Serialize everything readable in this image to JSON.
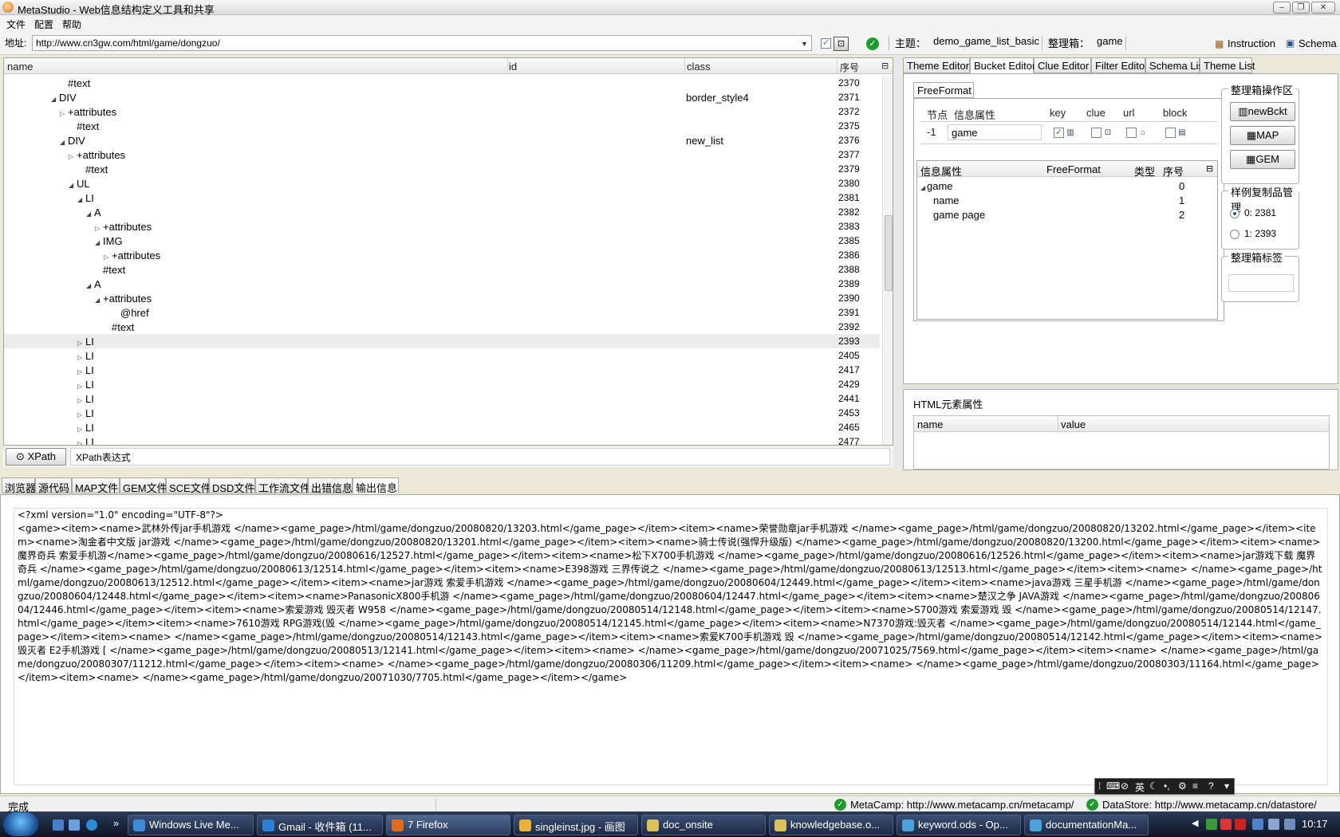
{
  "window": {
    "title": "MetaStudio - Web信息结构定义工具和共享",
    "btn_min": "–",
    "btn_max": "❐",
    "btn_close": "✕"
  },
  "menu": {
    "file": "文件",
    "config": "配置",
    "help": "帮助"
  },
  "address": {
    "label": "地址:",
    "url": "http://www.cn3gw.com/html/game/dongzuo/",
    "theme_label": "主题：",
    "theme_value": "demo_game_list_basic",
    "bucket_label": "整理箱：",
    "bucket_value": "game",
    "instruction": "Instruction",
    "schema": "Schema"
  },
  "tree": {
    "columns": {
      "name": "name",
      "id": "id",
      "class": "class",
      "seq": "序号"
    },
    "rows": [
      {
        "name": "#text",
        "indent": 6,
        "expander": "",
        "class": "",
        "seq": "2370"
      },
      {
        "name": "DIV",
        "indent": 5,
        "expander": "◢",
        "class": "border_style4",
        "seq": "2371"
      },
      {
        "name": "+attributes",
        "indent": 6,
        "expander": "▷",
        "class": "",
        "seq": "2372"
      },
      {
        "name": "#text",
        "indent": 7,
        "expander": "",
        "class": "",
        "seq": "2375"
      },
      {
        "name": "DIV",
        "indent": 6,
        "expander": "◢",
        "class": "new_list",
        "seq": "2376"
      },
      {
        "name": "+attributes",
        "indent": 7,
        "expander": "▷",
        "class": "",
        "seq": "2377"
      },
      {
        "name": "#text",
        "indent": 8,
        "expander": "",
        "class": "",
        "seq": "2379"
      },
      {
        "name": "UL",
        "indent": 7,
        "expander": "◢",
        "class": "",
        "seq": "2380"
      },
      {
        "name": "LI",
        "indent": 8,
        "expander": "◢",
        "class": "",
        "seq": "2381"
      },
      {
        "name": "A",
        "indent": 9,
        "expander": "◢",
        "class": "",
        "seq": "2382"
      },
      {
        "name": "+attributes",
        "indent": 10,
        "expander": "▷",
        "class": "",
        "seq": "2383"
      },
      {
        "name": "IMG",
        "indent": 10,
        "expander": "◢",
        "class": "",
        "seq": "2385"
      },
      {
        "name": "+attributes",
        "indent": 11,
        "expander": "▷",
        "class": "",
        "seq": "2386"
      },
      {
        "name": "#text",
        "indent": 10,
        "expander": "",
        "class": "",
        "seq": "2388"
      },
      {
        "name": "A",
        "indent": 9,
        "expander": "◢",
        "class": "",
        "seq": "2389"
      },
      {
        "name": "+attributes",
        "indent": 10,
        "expander": "◢",
        "class": "",
        "seq": "2390"
      },
      {
        "name": "@href",
        "indent": 12,
        "expander": "",
        "class": "",
        "seq": "2391"
      },
      {
        "name": "#text",
        "indent": 11,
        "expander": "",
        "class": "",
        "seq": "2392"
      },
      {
        "name": "LI",
        "indent": 8,
        "expander": "▷",
        "class": "",
        "seq": "2393",
        "selected": true
      },
      {
        "name": "LI",
        "indent": 8,
        "expander": "▷",
        "class": "",
        "seq": "2405"
      },
      {
        "name": "LI",
        "indent": 8,
        "expander": "▷",
        "class": "",
        "seq": "2417"
      },
      {
        "name": "LI",
        "indent": 8,
        "expander": "▷",
        "class": "",
        "seq": "2429"
      },
      {
        "name": "LI",
        "indent": 8,
        "expander": "▷",
        "class": "",
        "seq": "2441"
      },
      {
        "name": "LI",
        "indent": 8,
        "expander": "▷",
        "class": "",
        "seq": "2453"
      },
      {
        "name": "LI",
        "indent": 8,
        "expander": "▷",
        "class": "",
        "seq": "2465"
      },
      {
        "name": "LI",
        "indent": 8,
        "expander": "▷",
        "class": "",
        "seq": "2477"
      }
    ]
  },
  "xpath": {
    "button": "XPath",
    "placeholder": "XPath表达式"
  },
  "right_tabs": [
    "Theme Editor",
    "Bucket Editor",
    "Clue Editor",
    "Filter Editor",
    "Schema List",
    "Theme List"
  ],
  "bucket": {
    "freeformat_tab": "FreeFormat",
    "headers": {
      "node": "节点",
      "info": "信息属性",
      "key": "key",
      "clue": "clue",
      "url": "url",
      "block": "block"
    },
    "node_value": "-1",
    "info_value": "game",
    "prop_columns": {
      "info": "信息属性",
      "ff": "FreeFormat",
      "type": "类型",
      "seq": "序号"
    },
    "props": [
      {
        "name": "game",
        "indent": 0,
        "expander": "◢",
        "seq": "0"
      },
      {
        "name": "name",
        "indent": 1,
        "expander": "",
        "seq": "1"
      },
      {
        "name": "game page",
        "indent": 1,
        "expander": "",
        "seq": "2"
      }
    ],
    "ops_label": "整理箱操作区",
    "btn_new": "newBckt",
    "btn_map": "MAP",
    "btn_gem": "GEM",
    "sample_label": "样例复制品管理",
    "sample1": "0: 2381",
    "sample2": "1: 2393",
    "tag_label": "整理箱标签"
  },
  "html_prop": {
    "title": "HTML元素属性",
    "col_name": "name",
    "col_value": "value"
  },
  "bottom_tabs": [
    "浏览器",
    "源代码",
    "MAP文件",
    "GEM文件",
    "SCE文件",
    "DSD文件",
    "工作流文件",
    "出错信息",
    "输出信息"
  ],
  "output_text": "<?xml version=\"1.0\" encoding=\"UTF-8\"?>\n<game><item><name>武林外传jar手机游戏 </name><game_page>/html/game/dongzuo/20080820/13203.html</game_page></item><item><name>荣誉勋章jar手机游戏 </name><game_page>/html/game/dongzuo/20080820/13202.html</game_page></item><item><name>淘金者中文版 jar游戏 </name><game_page>/html/game/dongzuo/20080820/13201.html</game_page></item><item><name>骑士传说(强悍升级版) </name><game_page>/html/game/dongzuo/20080820/13200.html</game_page></item><item><name>魔界奇兵 索爱手机游</name><game_page>/html/game/dongzuo/20080616/12527.html</game_page></item><item><name>松下X700手机游戏 </name><game_page>/html/game/dongzuo/20080616/12526.html</game_page></item><item><name>jar游戏下载 魔界奇兵 </name><game_page>/html/game/dongzuo/20080613/12514.html</game_page></item><item><name>E398游戏 三界传说之 </name><game_page>/html/game/dongzuo/20080613/12513.html</game_page></item><item><name> </name><game_page>/html/game/dongzuo/20080613/12512.html</game_page></item><item><name>jar游戏 索爱手机游戏 </name><game_page>/html/game/dongzuo/20080604/12449.html</game_page></item><item><name>java游戏 三星手机游 </name><game_page>/html/game/dongzuo/20080604/12448.html</game_page></item><item><name>PanasonicX800手机游 </name><game_page>/html/game/dongzuo/20080604/12447.html</game_page></item><item><name>楚汉之争 JAVA游戏 </name><game_page>/html/game/dongzuo/20080604/12446.html</game_page></item><item><name>索爱游戏 毁灭者 W958 </name><game_page>/html/game/dongzuo/20080514/12148.html</game_page></item><item><name>S700游戏 索爱游戏 毁 </name><game_page>/html/game/dongzuo/20080514/12147.html</game_page></item><item><name>7610游戏 RPG游戏(毁 </name><game_page>/html/game/dongzuo/20080514/12145.html</game_page></item><item><name>N7370游戏:毁灭者 </name><game_page>/html/game/dongzuo/20080514/12144.html</game_page></item><item><name> </name><game_page>/html/game/dongzuo/20080514/12143.html</game_page></item><item><name>索爱K700手机游戏 毁 </name><game_page>/html/game/dongzuo/20080514/12142.html</game_page></item><item><name>毁灭者 E2手机游戏 [ </name><game_page>/html/game/dongzuo/20080513/12141.html</game_page></item><item><name> </name><game_page>/html/game/dongzuo/20071025/7569.html</game_page></item><item><name> </name><game_page>/html/game/dongzuo/20080307/11212.html</game_page></item><item><name> </name><game_page>/html/game/dongzuo/20080306/11209.html</game_page></item><item><name> </name><game_page>/html/game/dongzuo/20080303/11164.html</game_page></item><item><name> </name><game_page>/html/game/dongzuo/20071030/7705.html</game_page></item></game>",
  "ime": {
    "lang": "英"
  },
  "status": {
    "left": "完成",
    "metacamp": "MetaCamp: http://www.metacamp.cn/metacamp/",
    "datastore": "DataStore: http://www.metacamp.cn/datastore/"
  },
  "taskbar": {
    "items": [
      "Windows Live Me...",
      "Gmail - 收件箱 (11...",
      "7 Firefox",
      "singleinst.jpg - 画图",
      "doc_onsite",
      "knowledgebase.o...",
      "keyword.ods - Op...",
      "documentationMa..."
    ],
    "clock": "10:17",
    "more": "»"
  }
}
